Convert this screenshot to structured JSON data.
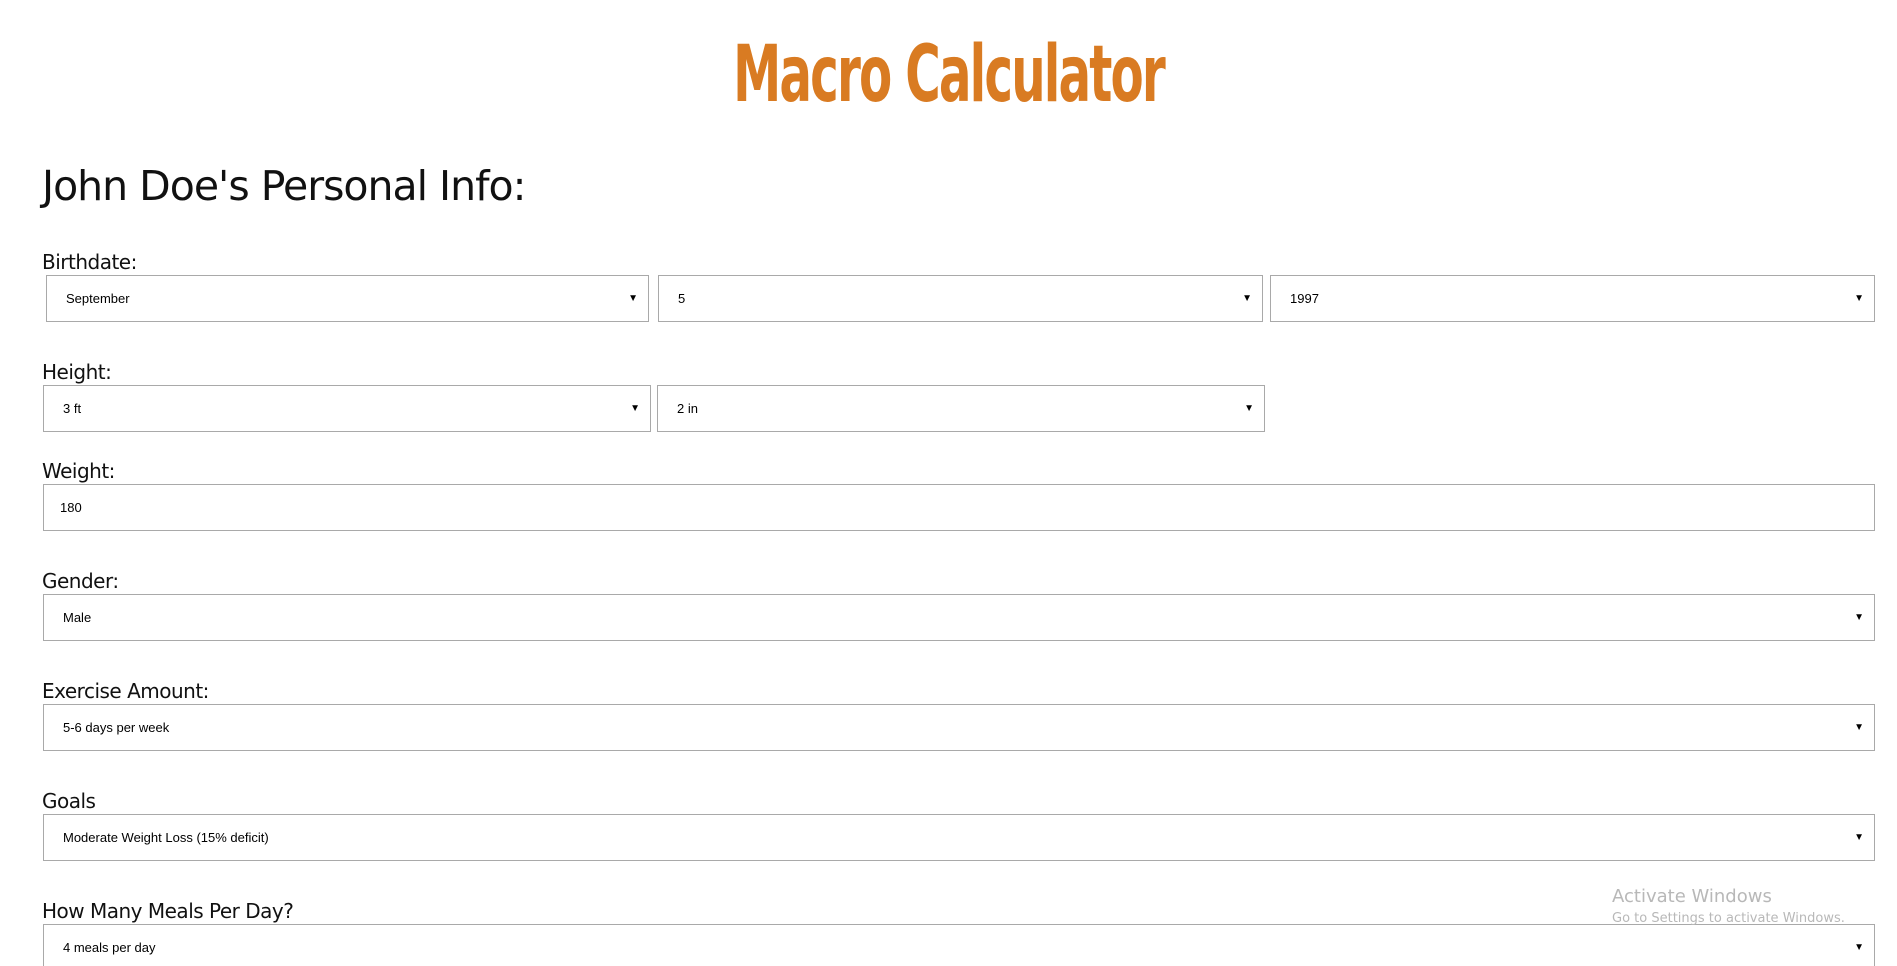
{
  "app": {
    "title": "Macro Calculator",
    "title_color": "#d97b22"
  },
  "section": {
    "heading": "John Doe's Personal Info:"
  },
  "form": {
    "birthdate": {
      "label": "Birthdate:",
      "month": "September",
      "day": "5",
      "year": "1997"
    },
    "height": {
      "label": "Height:",
      "feet": "3 ft",
      "inches": "2 in"
    },
    "weight": {
      "label": "Weight:",
      "value": "180"
    },
    "gender": {
      "label": "Gender:",
      "value": "Male"
    },
    "exercise": {
      "label": "Exercise Amount:",
      "value": "5-6 days per week"
    },
    "goals": {
      "label": "Goals",
      "value": "Moderate Weight Loss (15% deficit)"
    },
    "meals": {
      "label": "How Many Meals Per Day?",
      "value": "4 meals per day"
    }
  },
  "dropdown_arrow": "▼",
  "watermark": {
    "title": "Activate Windows",
    "subtitle": "Go to Settings to activate Windows."
  }
}
